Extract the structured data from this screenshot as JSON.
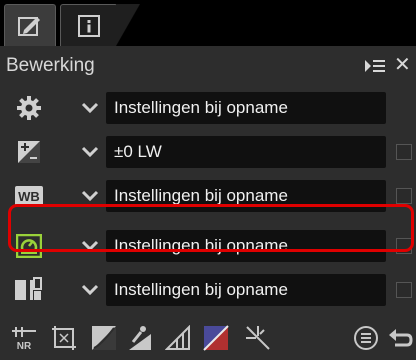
{
  "tabs": [
    {
      "icon": "edit-pen-icon",
      "active": true
    },
    {
      "icon": "info-icon",
      "active": false
    }
  ],
  "panel": {
    "title": "Bewerking"
  },
  "rows": [
    {
      "icon": "gear-icon",
      "value": "Instellingen bij opname",
      "checkbox": false
    },
    {
      "icon": "exposure-compensation-icon",
      "value": "±0 LW",
      "checkbox": true
    },
    {
      "icon": "white-balance-icon",
      "value": "Instellingen bij opname",
      "checkbox": true
    },
    {
      "icon": "picture-control-icon",
      "value": "Instellingen bij opname",
      "checkbox": true
    },
    {
      "icon": "active-d-lighting-icon",
      "value": "Instellingen bij opname",
      "checkbox": true
    }
  ],
  "toolbar": [
    "noise-reduction-icon",
    "crop-icon",
    "levels-curves-icon",
    "lch-icon",
    "color-balance-icon",
    "color-booster-icon",
    "retouch-brush-icon",
    "version-list-icon",
    "undo-icon"
  ],
  "colors": {
    "highlight": "#e00000",
    "accent_green": "#9ad23a",
    "panel_bg": "#2d2d2d"
  }
}
